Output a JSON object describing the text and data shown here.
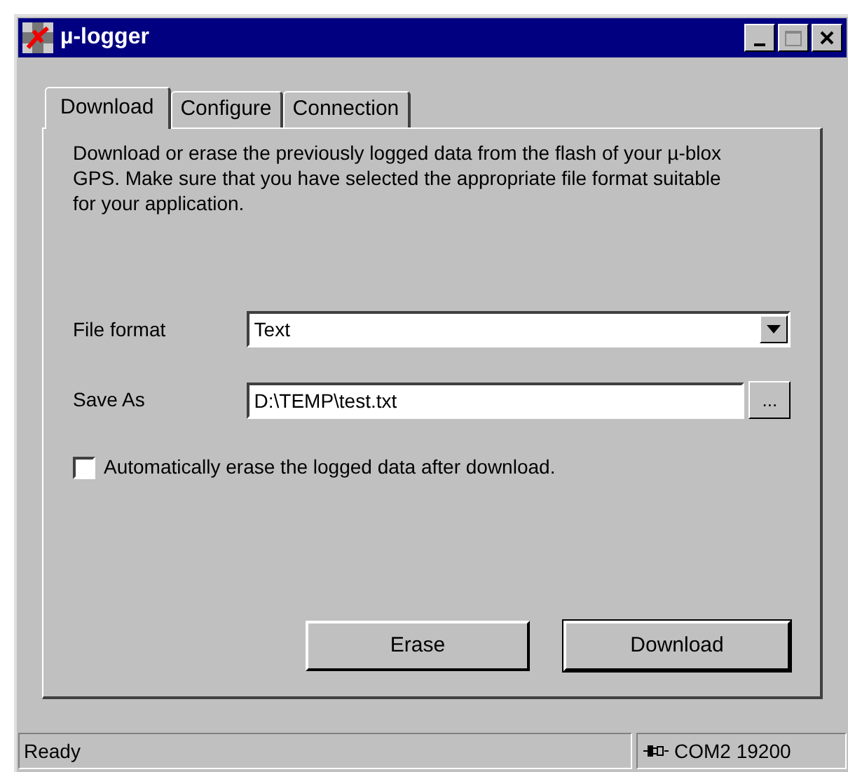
{
  "window": {
    "title": "µ-logger"
  },
  "tabs": [
    {
      "label": "Download",
      "selected": true
    },
    {
      "label": "Configure",
      "selected": false
    },
    {
      "label": "Connection",
      "selected": false
    }
  ],
  "description": "Download or erase the previously logged data from the flash of your µ-blox GPS. Make sure that you have selected the appropriate file format suitable for your application.",
  "file_format": {
    "label": "File format",
    "value": "Text"
  },
  "save_as": {
    "label": "Save As",
    "value": "D:\\TEMP\\test.txt",
    "browse": "..."
  },
  "auto_erase": {
    "label": "Automatically erase the logged data after download.",
    "checked": false
  },
  "buttons": [
    "Erase",
    "Download"
  ],
  "status_bar": {
    "message": "Ready",
    "connection": "COM2 19200"
  }
}
